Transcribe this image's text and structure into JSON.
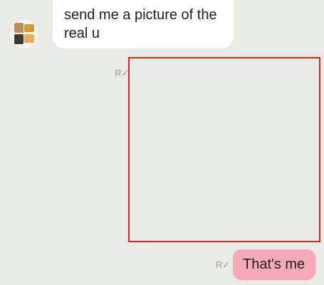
{
  "incoming": {
    "avatar_icon": "contact-avatar",
    "message": "send me a picture of the real u"
  },
  "read_receipt": {
    "icon": "read-receipt-check",
    "glyph": "R✓"
  },
  "outgoing": {
    "photo_placeholder": "image-attachment",
    "message": "That's me"
  },
  "colors": {
    "background": "#e9ebe7",
    "incoming_bubble": "#ffffff",
    "outgoing_bubble": "#f6a9b8",
    "photo_border": "#e42020",
    "read_receipt": "#9a9a9a"
  }
}
